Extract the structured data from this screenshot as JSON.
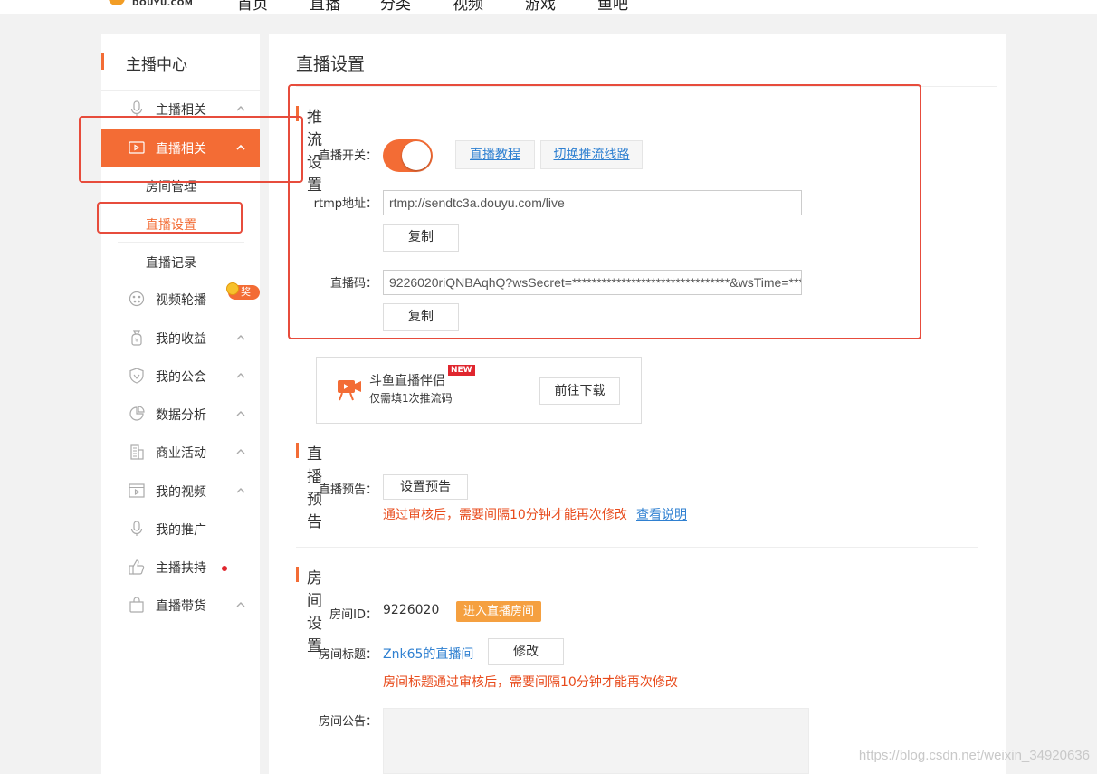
{
  "topnav": {
    "logo_text": "DOUYU.COM",
    "items": [
      "首页",
      "直播",
      "分类",
      "视频",
      "游戏",
      "鱼吧"
    ]
  },
  "sidebar": {
    "title": "主播中心",
    "items": [
      {
        "label": "主播相关",
        "icon": "microphone-icon",
        "chevron": "^"
      },
      {
        "label": "直播相关",
        "icon": "video-camera-icon",
        "chevron": "^",
        "active": true
      },
      {
        "label": "视频轮播",
        "icon": "film-reel-icon"
      },
      {
        "label": "我的收益",
        "icon": "money-bag-icon",
        "chevron": "^"
      },
      {
        "label": "我的公会",
        "icon": "shield-icon",
        "chevron": "^"
      },
      {
        "label": "数据分析",
        "icon": "pie-chart-icon",
        "chevron": "^"
      },
      {
        "label": "商业活动",
        "icon": "building-icon",
        "chevron": "^"
      },
      {
        "label": "我的视频",
        "icon": "video-player-icon",
        "chevron": "^"
      },
      {
        "label": "我的推广",
        "icon": "microphone-icon"
      },
      {
        "label": "主播扶持",
        "icon": "thumbs-up-icon"
      },
      {
        "label": "直播带货",
        "icon": "shopping-bag-icon",
        "chevron": "^"
      }
    ],
    "subitems": [
      "房间管理",
      "直播设置",
      "直播记录"
    ],
    "reward_badge": "奖励"
  },
  "main": {
    "page_title": "直播设置",
    "push": {
      "title": "推流设置",
      "switch_label": "直播开关：",
      "switch_on": true,
      "tutorial_link": "直播教程",
      "switch_line_link": "切换推流线路",
      "rtmp_label": "rtmp地址：",
      "rtmp_value": "rtmp://sendtc3a.douyu.com/live",
      "copy_label": "复制",
      "code_label": "直播码：",
      "code_value": "9226020riQNBAqhQ?wsSecret=********************************&wsTime=***&wsSeek=off"
    },
    "companion": {
      "name": "斗鱼直播伴侣",
      "badge": "NEW",
      "desc": "仅需填1次推流码",
      "download_label": "前往下载"
    },
    "preview": {
      "title": "直播预告",
      "label": "直播预告：",
      "button": "设置预告",
      "warning": "通过审核后，需要间隔10分钟才能再次修改",
      "help_link": "查看说明"
    },
    "room": {
      "title": "房间设置",
      "id_label": "房间ID：",
      "id_value": "9226020",
      "enter_button": "进入直播房间",
      "title_label": "房间标题：",
      "title_value": "Znk65的直播间",
      "modify_button": "修改",
      "title_warning": "房间标题通过审核后，需要间隔10分钟才能再次修改",
      "notice_label": "房间公告："
    }
  },
  "watermark": "https://blog.csdn.net/weixin_34920636",
  "colors": {
    "accent": "#f36c35",
    "link": "#2f80d1",
    "warning": "#e84b1c",
    "highlight_box": "#e74c3c"
  }
}
